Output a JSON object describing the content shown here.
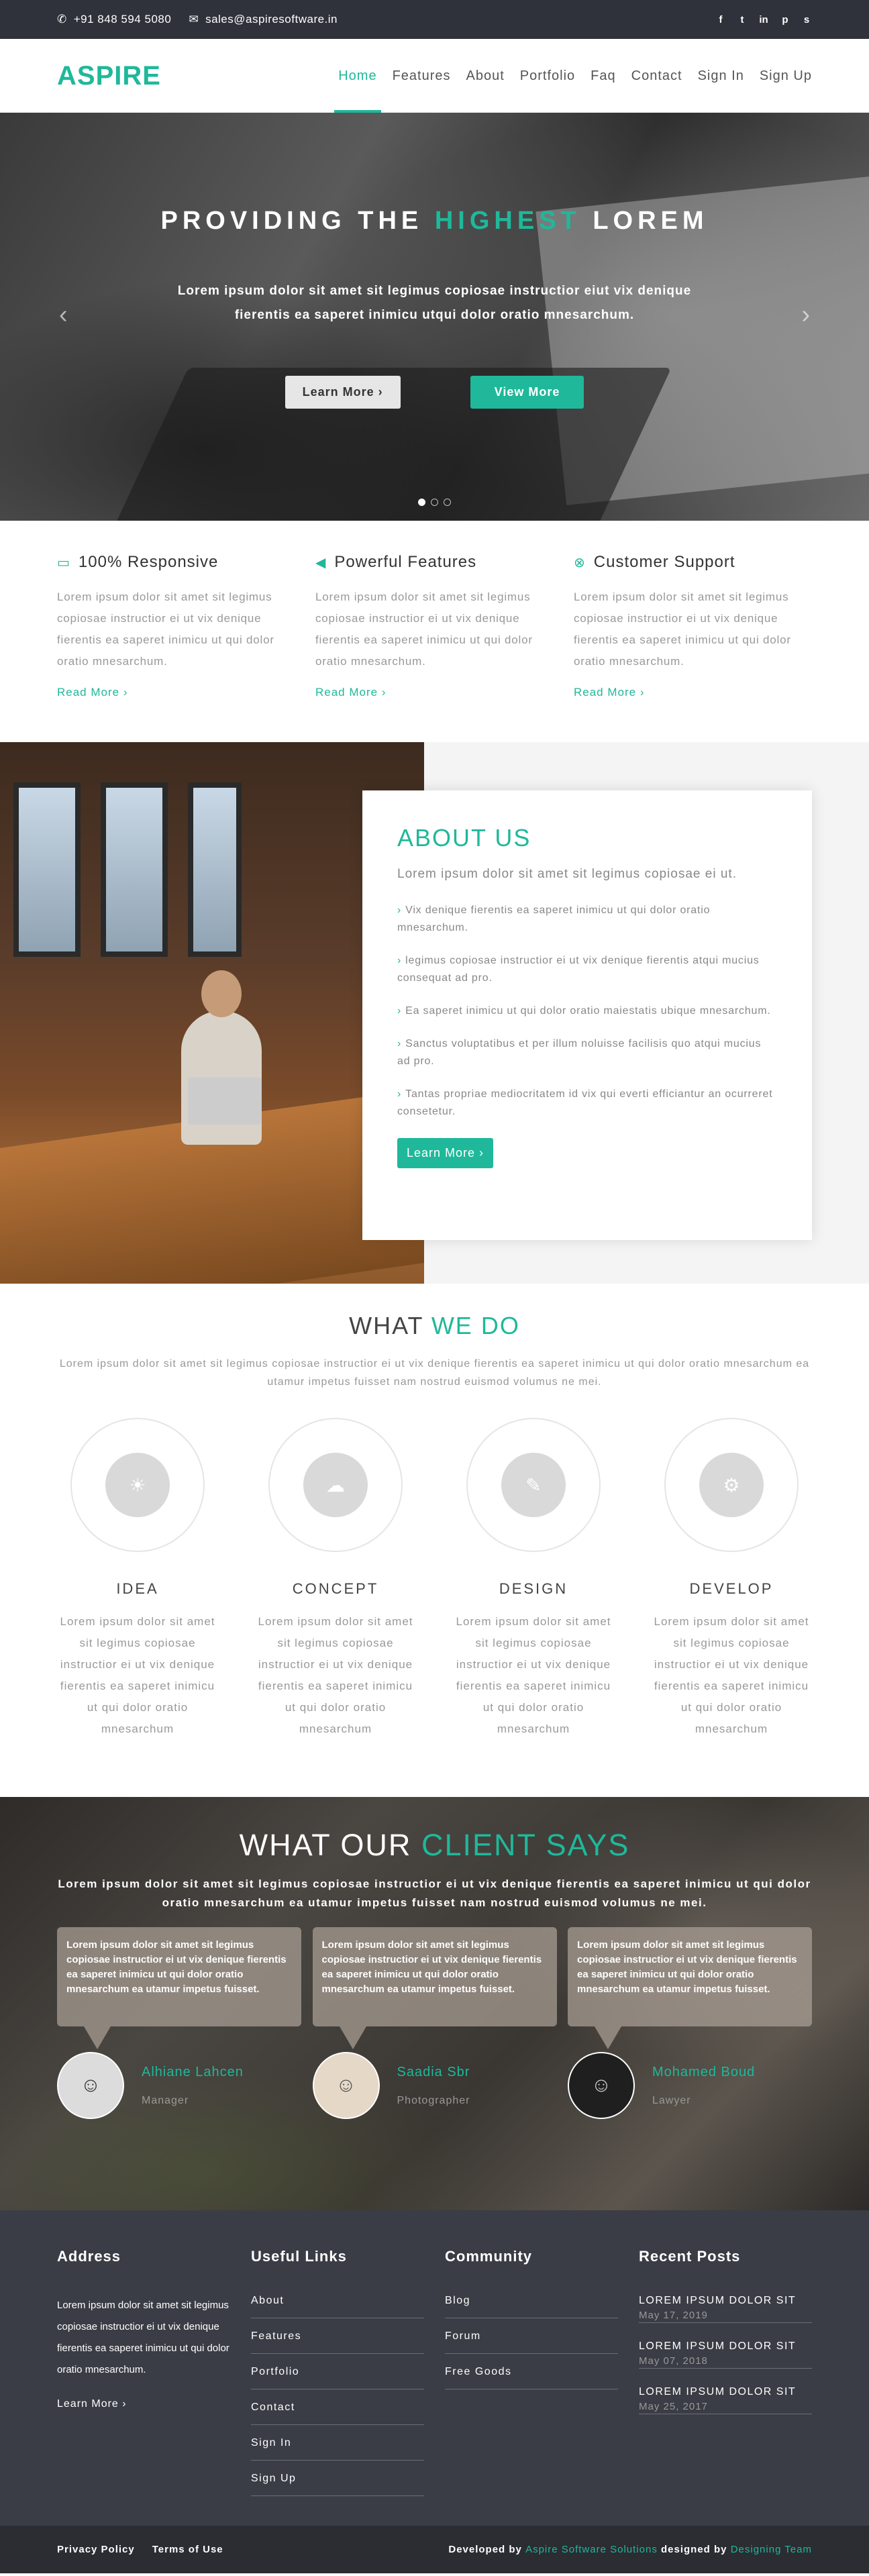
{
  "topbar": {
    "phone": "+91 848 594 5080",
    "email": "sales@aspiresoftware.in",
    "social": [
      "facebook-icon",
      "twitter-icon",
      "linkedin-icon",
      "pinterest-icon",
      "skype-icon"
    ]
  },
  "header": {
    "logo": "ASPIRE",
    "nav": [
      "Home",
      "Features",
      "About",
      "Portfolio",
      "Faq",
      "Contact",
      "Sign In",
      "Sign Up"
    ]
  },
  "hero": {
    "title_pre": "PROVIDING THE",
    "title_accent": "HIGHEST",
    "title_post": "LOREM",
    "text": "Lorem ipsum dolor sit amet sit legimus copiosae instructior eiut vix denique fierentis ea saperet inimicu utqui dolor oratio mnesarchum.",
    "btn_learn": "Learn More ›",
    "btn_view": "View More"
  },
  "features": [
    {
      "icon": "laptop-icon",
      "title": "100% Responsive",
      "text": "Lorem ipsum dolor sit amet sit legimus copiosae instructior ei ut vix denique fierentis ea saperet inimicu ut qui dolor oratio mnesarchum.",
      "more": "Read More ›"
    },
    {
      "icon": "bullhorn-icon",
      "title": "Powerful Features",
      "text": "Lorem ipsum dolor sit amet sit legimus copiosae instructior ei ut vix denique fierentis ea saperet inimicu ut qui dolor oratio mnesarchum.",
      "more": "Read More ›"
    },
    {
      "icon": "support-icon",
      "title": "Customer Support",
      "text": "Lorem ipsum dolor sit amet sit legimus copiosae instructior ei ut vix denique fierentis ea saperet inimicu ut qui dolor oratio mnesarchum.",
      "more": "Read More ›"
    }
  ],
  "about": {
    "title": "ABOUT US",
    "lead": "Lorem ipsum dolor sit amet sit legimus copiosae ei ut.",
    "items": [
      "Vix denique fierentis ea saperet inimicu ut qui dolor oratio mnesarchum.",
      "legimus copiosae instructior ei ut vix denique fierentis atqui mucius consequat ad pro.",
      "Ea saperet inimicu ut qui dolor oratio maiestatis ubique mnesarchum.",
      "Sanctus voluptatibus et per illum noluisse facilisis quo atqui mucius ad pro.",
      "Tantas propriae mediocritatem id vix qui everti efficiantur an ocurreret consetetur."
    ],
    "btn": "Learn More ›"
  },
  "whatwedo": {
    "title_pre": "WHAT",
    "title_accent": "WE DO",
    "intro": "Lorem ipsum dolor sit amet sit legimus copiosae instructior ei ut vix denique fierentis ea saperet inimicu ut qui dolor oratio mnesarchum ea utamur impetus fuisset nam nostrud euismod volumus ne mei.",
    "steps": [
      {
        "icon": "lightbulb-icon",
        "title": "IDEA",
        "text": "Lorem ipsum dolor sit amet sit legimus copiosae instructior ei ut vix denique fierentis ea saperet inimicu ut qui dolor oratio mnesarchum"
      },
      {
        "icon": "cloud-download-icon",
        "title": "CONCEPT",
        "text": "Lorem ipsum dolor sit amet sit legimus copiosae instructior ei ut vix denique fierentis ea saperet inimicu ut qui dolor oratio mnesarchum"
      },
      {
        "icon": "magic-wand-icon",
        "title": "DESIGN",
        "text": "Lorem ipsum dolor sit amet sit legimus copiosae instructior ei ut vix denique fierentis ea saperet inimicu ut qui dolor oratio mnesarchum"
      },
      {
        "icon": "gear-icon",
        "title": "DEVELOP",
        "text": "Lorem ipsum dolor sit amet sit legimus copiosae instructior ei ut vix denique fierentis ea saperet inimicu ut qui dolor oratio mnesarchum"
      }
    ]
  },
  "testimonials": {
    "title_pre": "WHAT OUR",
    "title_accent": "CLIENT SAYS",
    "intro": "Lorem ipsum dolor sit amet sit legimus copiosae instructior ei ut vix denique fierentis ea saperet inimicu ut qui dolor oratio mnesarchum ea utamur impetus fuisset nam nostrud euismod volumus ne mei.",
    "items": [
      {
        "quote": "Lorem ipsum dolor sit amet sit legimus copiosae instructior ei ut vix denique fierentis ea saperet inimicu ut qui dolor oratio mnesarchum ea utamur impetus fuisset.",
        "name": "Alhiane Lahcen",
        "role": "Manager",
        "avatar_color": "#dcdcdc"
      },
      {
        "quote": "Lorem ipsum dolor sit amet sit legimus copiosae instructior ei ut vix denique fierentis ea saperet inimicu ut qui dolor oratio mnesarchum ea utamur impetus fuisset.",
        "name": "Saadia Sbr",
        "role": "Photographer",
        "avatar_color": "#e6d8c6"
      },
      {
        "quote": "Lorem ipsum dolor sit amet sit legimus copiosae instructior ei ut vix denique fierentis ea saperet inimicu ut qui dolor oratio mnesarchum ea utamur impetus fuisset.",
        "name": "Mohamed Boud",
        "role": "Lawyer",
        "avatar_color": "#1f1f1f"
      }
    ]
  },
  "footer": {
    "address_title": "Address",
    "address_text": "Lorem ipsum dolor sit amet sit legimus copiosae instructior ei ut vix denique fierentis ea saperet inimicu ut qui dolor oratio mnesarchum.",
    "address_more": "Learn More ›",
    "links_title": "Useful Links",
    "links": [
      "About",
      "Features",
      "Portfolio",
      "Contact",
      "Sign In",
      "Sign Up"
    ],
    "community_title": "Community",
    "community": [
      "Blog",
      "Forum",
      "Free Goods"
    ],
    "posts_title": "Recent Posts",
    "posts": [
      {
        "title": "LOREM IPSUM DOLOR SIT",
        "date": "May 17, 2019"
      },
      {
        "title": "LOREM IPSUM DOLOR SIT",
        "date": "May 07, 2018"
      },
      {
        "title": "LOREM IPSUM DOLOR SIT",
        "date": "May 25, 2017"
      }
    ]
  },
  "bottom": {
    "privacy": "Privacy Policy",
    "terms": "Terms of Use",
    "dev_pre": "Developed by",
    "dev_company": "Aspire Software Solutions",
    "design_pre": "designed by",
    "design_company": "Designing Team"
  },
  "colors": {
    "accent": "#1fb89a",
    "dark": "#2f323a",
    "footer": "#3a3d45"
  }
}
